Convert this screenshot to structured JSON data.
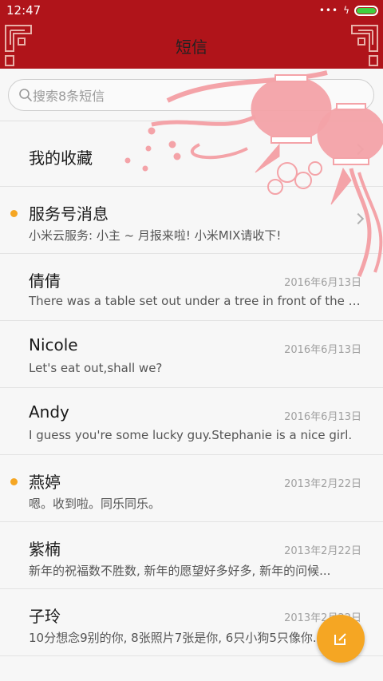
{
  "status": {
    "time": "12:47",
    "dots": "•••",
    "bolt": "ϟ",
    "battery_level": 1.0
  },
  "header": {
    "title": "短信"
  },
  "search": {
    "placeholder": "搜索8条短信"
  },
  "favorites": {
    "label": "我的收藏"
  },
  "messages": [
    {
      "name": "服务号消息",
      "date": "",
      "preview": "小米云服务: 小主 ~ 月报来啦! 小米MIX请收下!",
      "unread": true
    },
    {
      "name": "倩倩",
      "date": "2016年6月13日",
      "preview": "There was a table set out under a tree in front of the ho...",
      "unread": false
    },
    {
      "name": "Nicole",
      "date": "2016年6月13日",
      "preview": "Let's eat out,shall we?",
      "unread": false
    },
    {
      "name": "Andy",
      "date": "2016年6月13日",
      "preview": "I guess you're some lucky guy.Stephanie is a nice girl.",
      "unread": false
    },
    {
      "name": "燕婷",
      "date": "2013年2月22日",
      "preview": "嗯。收到啦。同乐同乐。",
      "unread": true
    },
    {
      "name": "紫楠",
      "date": "2013年2月22日",
      "preview": "新年的祝福数不胜数, 新年的愿望好多好多, 新年的问候...",
      "unread": false
    },
    {
      "name": "子玲",
      "date": "2013年2月22日",
      "preview": "10分想念9别的你, 8张照片7张是你, 6只小狗5只像你...",
      "unread": false
    }
  ],
  "colors": {
    "header_bg": "#b0141a",
    "accent": "#f5a623",
    "lantern": "#f4a3a8"
  },
  "icons": {
    "compose": "compose-icon",
    "search": "search-icon",
    "chevron": "chevron-right-icon"
  }
}
